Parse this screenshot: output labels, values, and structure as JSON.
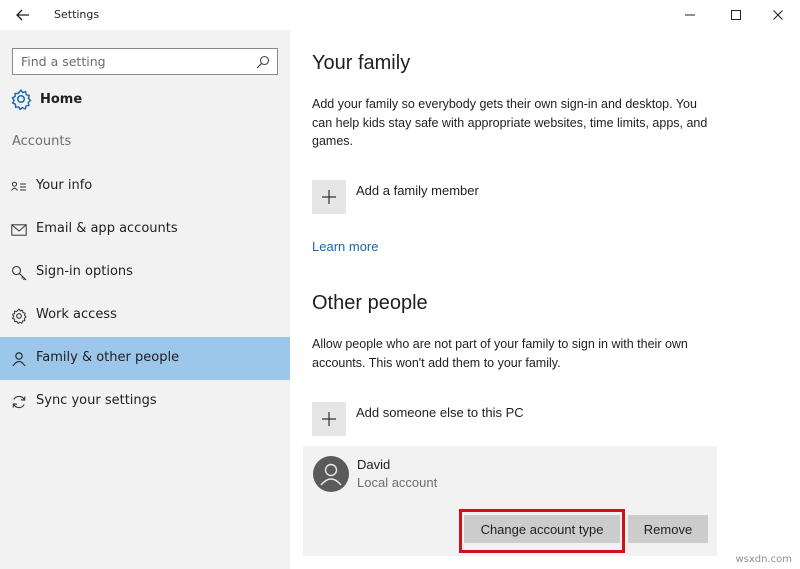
{
  "window": {
    "title": "Settings",
    "controls": [
      "minimize-icon",
      "maximize-icon",
      "close-icon"
    ]
  },
  "sidebar": {
    "search": {
      "placeholder": "Find a setting",
      "value": ""
    },
    "home_label": "Home",
    "section_label": "Accounts",
    "items": [
      {
        "label": "Your info",
        "icon": "person-card-icon",
        "active": false
      },
      {
        "label": "Email & app accounts",
        "icon": "mail-icon",
        "active": false
      },
      {
        "label": "Sign-in options",
        "icon": "key-icon",
        "active": false
      },
      {
        "label": "Work access",
        "icon": "gear-icon",
        "active": false
      },
      {
        "label": "Family & other people",
        "icon": "person-icon",
        "active": true
      },
      {
        "label": "Sync your settings",
        "icon": "sync-icon",
        "active": false
      }
    ]
  },
  "main": {
    "family": {
      "title": "Your family",
      "description": "Add your family so everybody gets their own sign-in and desktop. You can help kids stay safe with appropriate websites, time limits, apps, and games.",
      "add_label": "Add a family member",
      "learn_more": "Learn more"
    },
    "other": {
      "title": "Other people",
      "description": "Allow people who are not part of your family to sign in with their own accounts. This won't add them to your family.",
      "add_label": "Add someone else to this PC"
    },
    "account": {
      "name": "David",
      "type": "Local account",
      "change_button": "Change account type",
      "remove_button": "Remove"
    },
    "highlight_color": "#d0111b"
  },
  "colors": {
    "active_nav": "#9cc6ea",
    "link": "#1a66b3",
    "sidebar_bg": "#f2f2f2"
  },
  "watermark": "wsxdn.com"
}
